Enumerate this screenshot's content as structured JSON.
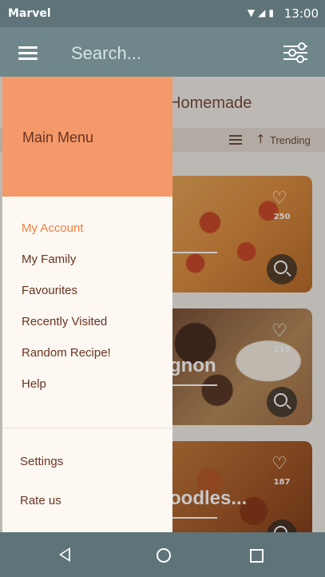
{
  "status_bar": {
    "carrier": "Marvel",
    "time": "13:00"
  },
  "app_bar": {
    "search_placeholder": "Search..."
  },
  "content": {
    "title": "Homemade",
    "sort_label": "Trending",
    "recipes": [
      {
        "name": "",
        "likes": "250"
      },
      {
        "name": "gnon",
        "likes": "213"
      },
      {
        "name": "oodles...",
        "likes": "187"
      }
    ]
  },
  "drawer": {
    "header": "Main Menu",
    "items": [
      {
        "label": "My Account",
        "active": true
      },
      {
        "label": "My Family"
      },
      {
        "label": "Favourites"
      },
      {
        "label": "Recently Visited"
      },
      {
        "label": "Random Recipe!"
      },
      {
        "label": "Help"
      }
    ],
    "secondary_items": [
      {
        "label": "Settings"
      },
      {
        "label": "Rate us"
      }
    ]
  },
  "colors": {
    "app_bar": "#6f878b",
    "status_bar": "#5e7478",
    "drawer_header": "#f4996a",
    "accent": "#f07f3c",
    "text": "#6a3322"
  },
  "icons": [
    "menu-icon",
    "filter-icon",
    "wifi-icon",
    "signal-icon",
    "battery-icon",
    "list-icon",
    "arrow-up-icon",
    "heart-icon",
    "search-icon",
    "back-icon",
    "home-icon",
    "recents-icon"
  ]
}
